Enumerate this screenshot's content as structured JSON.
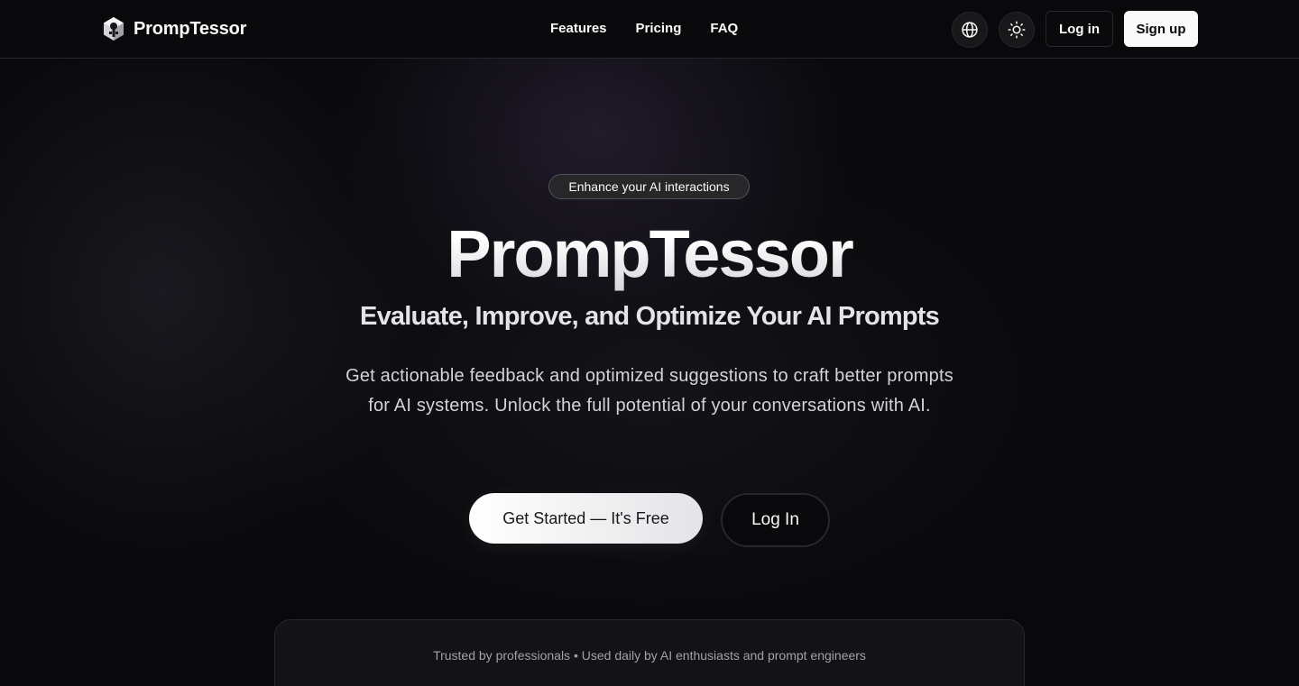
{
  "header": {
    "brand_name": "PrompTessor",
    "nav": [
      "Features",
      "Pricing",
      "FAQ"
    ],
    "login_label": "Log in",
    "signup_label": "Sign up",
    "icons": [
      "globe-icon",
      "sun-icon"
    ]
  },
  "hero": {
    "badge": "Enhance your AI interactions",
    "title": "PrompTessor",
    "subtitle": "Evaluate, Improve, and Optimize Your AI Prompts",
    "description": "Get actionable feedback and optimized suggestions to craft better prompts for AI systems. Unlock the full potential of your conversations with AI.",
    "cta_primary": "Get Started — It's Free",
    "cta_secondary": "Log In"
  },
  "trust": {
    "text": "Trusted by professionals • Used daily by AI enthusiasts and prompt engineers"
  },
  "colors": {
    "background": "#09090b",
    "border": "#27272a",
    "foreground": "#fafafa",
    "muted": "#a1a1aa"
  }
}
